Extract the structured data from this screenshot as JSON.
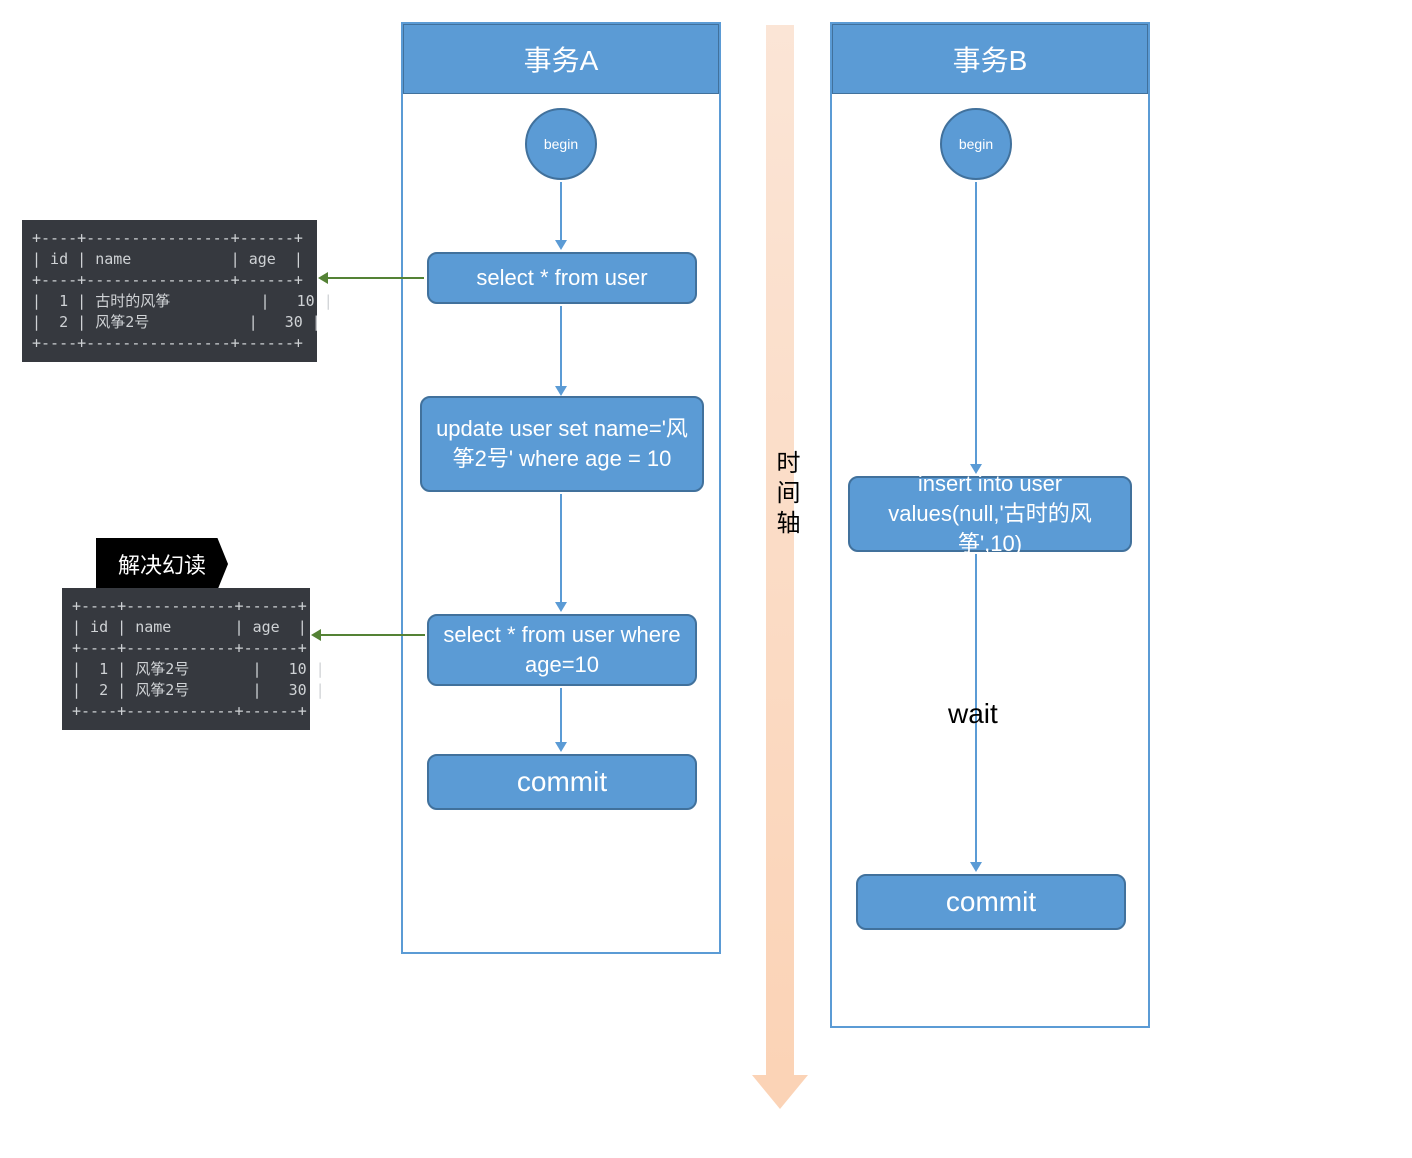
{
  "laneA": {
    "title": "事务A"
  },
  "laneB": {
    "title": "事务B"
  },
  "timeline_label": "时间轴",
  "nodesA": {
    "begin": "begin",
    "select1": "select * from user",
    "update": "update user set name='风筝2号' where age = 10",
    "select2": "select * from user where age=10",
    "commit": "commit"
  },
  "nodesB": {
    "begin": "begin",
    "insert": "insert into user values(null,'古时的风筝',10)",
    "wait": "wait",
    "commit": "commit"
  },
  "table1": {
    "header": [
      "id",
      "name",
      "age"
    ],
    "rows": [
      {
        "id": 1,
        "name": "古时的风筝",
        "age": 10
      },
      {
        "id": 2,
        "name": "风筝2号",
        "age": 30
      }
    ]
  },
  "table2": {
    "badge": "解决幻读",
    "header": [
      "id",
      "name",
      "age"
    ],
    "rows": [
      {
        "id": 1,
        "name": "风筝2号",
        "age": 10
      },
      {
        "id": 2,
        "name": "风筝2号",
        "age": 30
      }
    ]
  }
}
